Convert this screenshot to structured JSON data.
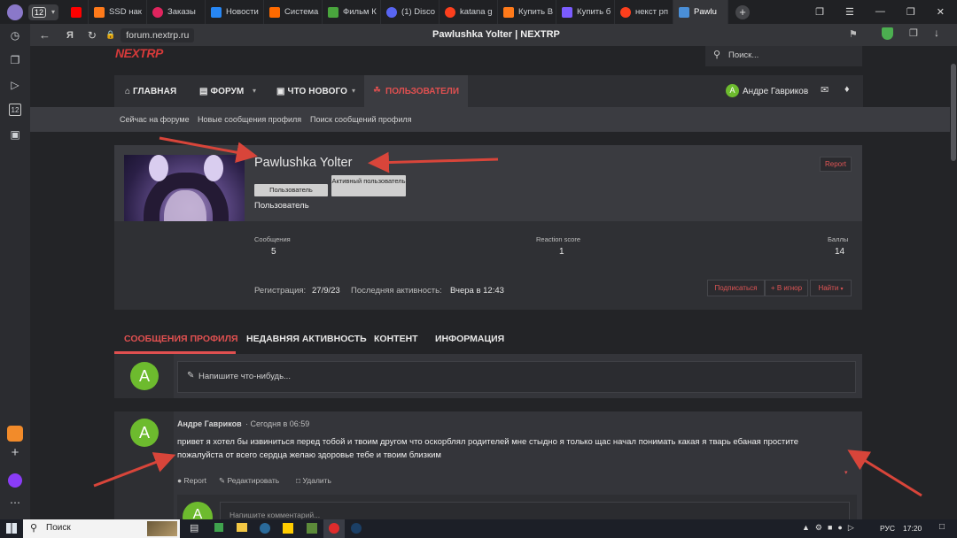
{
  "browser": {
    "profile_badge": "12",
    "tabs": [
      {
        "label": "",
        "color": "#ff0000"
      },
      {
        "label": "SSD нак",
        "color": "#ff7a1a",
        "icon_text": "DNS"
      },
      {
        "label": "Заказы",
        "color": "#e0245e"
      },
      {
        "label": "Новости",
        "color": "#2787f5",
        "icon_text": "VK"
      },
      {
        "label": "Система",
        "color": "#ff6a00"
      },
      {
        "label": "Фильм К",
        "color": "#49a53d",
        "icon_text": "HD"
      },
      {
        "label": "(1) Disco",
        "color": "#5865f2"
      },
      {
        "label": "katana g",
        "color": "#fc3f1d"
      },
      {
        "label": "Купить В",
        "color": "#ff7a1a",
        "icon_text": "DNS"
      },
      {
        "label": "Купить б",
        "color": "#7b5cff"
      },
      {
        "label": "некст рп",
        "color": "#fc3f1d"
      },
      {
        "label": "Pawlu",
        "color": "#4a8fd8",
        "active": true
      }
    ],
    "address": "forum.nextrp.ru",
    "page_title": "Pawlushka Yolter | NEXTRP"
  },
  "site": {
    "logo": "NEXTRP",
    "search_placeholder": "Поиск...",
    "nav": {
      "home": "ГЛАВНАЯ",
      "forum": "ФОРУМ",
      "whats_new": "ЧТО НОВОГО",
      "users": "ПОЛЬЗОВАТЕЛИ"
    },
    "current_user": {
      "initial": "А",
      "name": "Андре Гавриков"
    },
    "subnav": {
      "online": "Сейчас на форуме",
      "new_profile_posts": "Новые сообщения профиля",
      "search_profile_posts": "Поиск сообщений профиля"
    }
  },
  "profile": {
    "name": "Pawlushka Yolter",
    "report": "Report",
    "banners": [
      "Пользователь",
      "Активный пользователь"
    ],
    "user_title": "Пользователь",
    "stats": {
      "messages_label": "Сообщения",
      "messages_value": "5",
      "reaction_label": "Reaction score",
      "reaction_value": "1",
      "points_label": "Баллы",
      "points_value": "14"
    },
    "registration_label": "Регистрация:",
    "registration_value": "27/9/23",
    "last_activity_label": "Последняя активность:",
    "last_activity_value": "Вчера в 12:43",
    "actions": {
      "follow": "Подписаться",
      "ignore": "+ В игнор",
      "find": "Найти"
    }
  },
  "profile_tabs": {
    "posts": "СООБЩЕНИЯ ПРОФИЛЯ",
    "recent": "НЕДАВНЯЯ АКТИВНОСТЬ",
    "content": "КОНТЕНТ",
    "info": "ИНФОРМАЦИЯ"
  },
  "compose": {
    "avatar_initial": "А",
    "placeholder": "Напишите что-нибудь..."
  },
  "post": {
    "avatar_initial": "А",
    "author": "Андре Гавриков",
    "time": "· Сегодня в 06:59",
    "text_line1": "привет я хотел бы извиниться перед тобой и твоим другом что оскорблял родителей мне стыдно я только щас начал понимать какая я тварь ебаная простите",
    "text_line2": "пожалуйста от всего сердца желаю здоровье тебе и твоим близким",
    "actions": {
      "report": "Report",
      "edit": "Редактировать",
      "delete": "Удалить"
    },
    "comment_placeholder": "Напишите комментарий..."
  },
  "taskbar": {
    "search": "Поиск",
    "lang": "РУС",
    "time": "17:20"
  },
  "colors": {
    "accent_red": "#e05050",
    "avatar_green": "#6dbb2e",
    "arrow_red": "#d8453a"
  }
}
